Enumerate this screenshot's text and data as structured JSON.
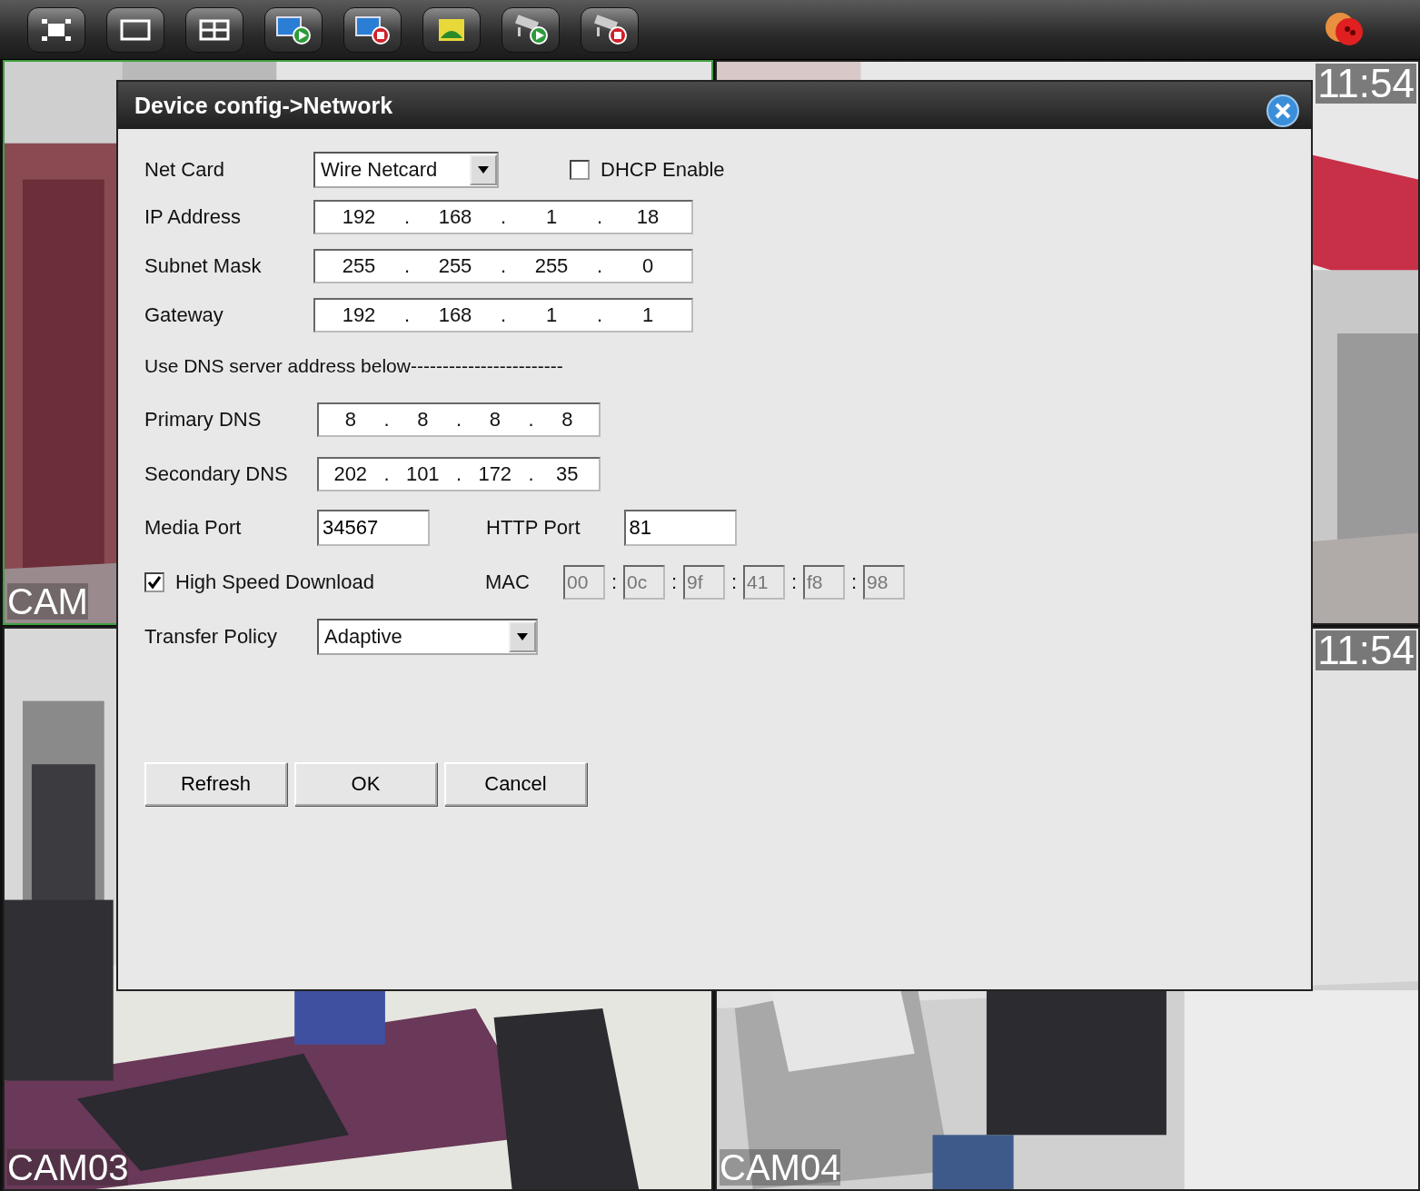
{
  "cameras": [
    {
      "label": "CAM"
    },
    {
      "time": "11:54"
    },
    {
      "label": "CAM03"
    },
    {
      "label": "CAM04",
      "time": "11:54"
    }
  ],
  "dialog": {
    "title": "Device config->Network",
    "net_card": {
      "label": "Net Card",
      "value": "Wire Netcard"
    },
    "dhcp": {
      "label": "DHCP Enable",
      "checked": false
    },
    "addresses": [
      {
        "label": "IP Address",
        "separator": ".",
        "octets": [
          "192",
          "168",
          "1",
          "18"
        ]
      },
      {
        "label": "Subnet Mask",
        "separator": ".",
        "octets": [
          "255",
          "255",
          "255",
          "0"
        ]
      },
      {
        "label": "Gateway",
        "separator": ".",
        "octets": [
          "192",
          "168",
          "1",
          "1"
        ]
      }
    ],
    "dns_note": "Use DNS server address below------------------------",
    "dns": [
      {
        "label": "Primary DNS",
        "separator": ".",
        "octets": [
          "8",
          "8",
          "8",
          "8"
        ]
      },
      {
        "label": "Secondary DNS",
        "separator": ".",
        "octets": [
          "202",
          "101",
          "172",
          "35"
        ]
      }
    ],
    "media_port": {
      "label": "Media Port",
      "value": "34567"
    },
    "http_port": {
      "label": "HTTP Port",
      "value": "81"
    },
    "high_speed": {
      "label": "High Speed Download",
      "checked": true
    },
    "mac": {
      "label": "MAC",
      "separator": ":",
      "parts": [
        "00",
        "0c",
        "9f",
        "41",
        "f8",
        "98"
      ]
    },
    "transfer_policy": {
      "label": "Transfer Policy",
      "value": "Adaptive"
    },
    "buttons": [
      "Refresh",
      "OK",
      "Cancel"
    ]
  }
}
